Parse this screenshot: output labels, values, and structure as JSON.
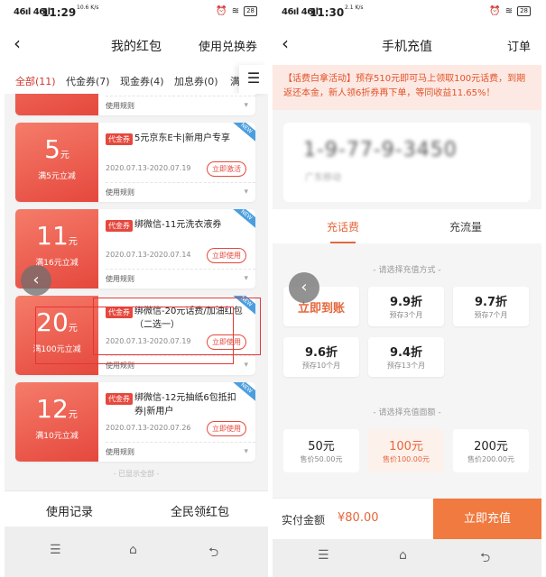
{
  "status_left": {
    "signal": "46ıl 46ıl",
    "time": "11:29",
    "speed": "10.6 K/s",
    "battery": "28"
  },
  "status_right": {
    "signal": "46ıl 46ıl",
    "time": "11:30",
    "speed": "2.1 K/s",
    "battery": "28"
  },
  "left": {
    "nav": {
      "back": "‹",
      "title": "我的红包",
      "action": "使用兑换券"
    },
    "tabs": [
      "全部(11)",
      "代金券(7)",
      "现金券(4)",
      "加息券(0)",
      "满"
    ],
    "menu_icon": "☰",
    "prev_rule": "使用规则",
    "coupons": [
      {
        "amount": "5",
        "unit": "元",
        "condition": "满5元立减",
        "tag": "代金券",
        "name": "5元京东E卡|新用户专享",
        "date": "2020.07.13-2020.07.19",
        "button": "立即激活",
        "rule": "使用规则",
        "badge": "NEW"
      },
      {
        "amount": "11",
        "unit": "元",
        "condition": "满16元立减",
        "tag": "代金券",
        "name": "绑微信-11元洗衣液券",
        "date": "2020.07.13-2020.07.14",
        "button": "立即使用",
        "rule": "使用规则",
        "badge": "NEW"
      },
      {
        "amount": "20",
        "unit": "元",
        "condition": "满100元立减",
        "tag": "代金券",
        "name": "绑微信-20元话费/加油红包（二选一）",
        "date": "2020.07.13-2020.07.19",
        "button": "立即使用",
        "rule": "使用规则",
        "badge": "NEW"
      },
      {
        "amount": "12",
        "unit": "元",
        "condition": "满10元立减",
        "tag": "代金券",
        "name": "绑微信-12元抽纸6包抵扣券|新用户",
        "date": "2020.07.13-2020.07.26",
        "button": "立即使用",
        "rule": "使用规则",
        "badge": "NEW"
      }
    ],
    "all_shown": "- 已显示全部 -",
    "footer": {
      "record": "使用记录",
      "share": "全民领红包"
    }
  },
  "right": {
    "nav": {
      "back": "‹",
      "title": "手机充值",
      "action": "订单"
    },
    "banner": "【话费白拿活动】预存510元即可马上领取100元话费，到期返还本金，新人领6折券再下单，等同收益11.65%！",
    "phone_number": "1-9-77-9-3450",
    "phone_sub": "广东移动",
    "tabs": [
      "充话费",
      "充流量"
    ],
    "method_title": "- 请选择充值方式 -",
    "methods": [
      {
        "label": "立即到账",
        "sub": ""
      },
      {
        "label": "9.9折",
        "sub": "预存3个月"
      },
      {
        "label": "9.7折",
        "sub": "预存7个月"
      },
      {
        "label": "9.6折",
        "sub": "预存10个月"
      },
      {
        "label": "9.4折",
        "sub": "预存13个月"
      }
    ],
    "amount_title": "- 请选择充值面额 -",
    "amounts": [
      {
        "label": "50元",
        "sub": "售价50.00元"
      },
      {
        "label": "100元",
        "sub": "售价100.00元"
      },
      {
        "label": "200元",
        "sub": "售价200.00元"
      }
    ],
    "pay": {
      "label": "实付金额",
      "amount": "¥80.00",
      "button": "立即充值"
    }
  },
  "sysnav": {
    "menu": "☰",
    "home": "⌂",
    "back": "⮌"
  },
  "float_back": "‹",
  "colors": {
    "coupon_red": "#e5483d",
    "accent_orange": "#e5673c",
    "pay_button": "#f07a3f",
    "highlight_box": "#e53535"
  }
}
